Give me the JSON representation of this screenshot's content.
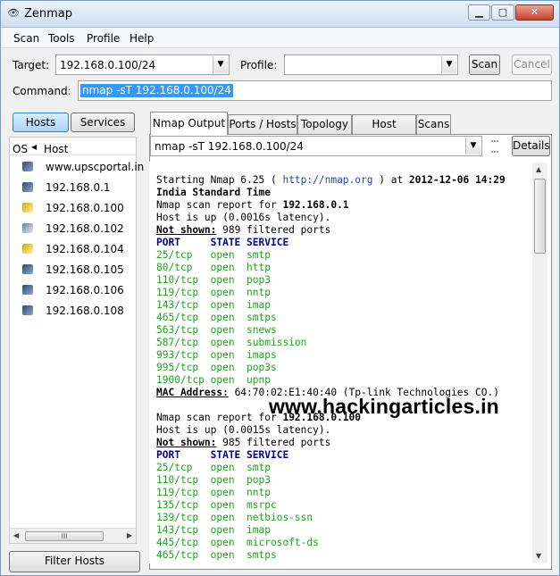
{
  "window": {
    "title": "Zenmap",
    "min_symbol": "▁",
    "max_symbol": "▢",
    "close_symbol": "✕",
    "app_icon": "eye-icon",
    "app_icon_glyph": "👁"
  },
  "menu": [
    "Scan",
    "Tools",
    "Profile",
    "Help"
  ],
  "target": {
    "label": "Target:",
    "value": "192.168.0.100/24"
  },
  "profile": {
    "label": "Profile:",
    "value": ""
  },
  "buttons": {
    "scan": "Scan",
    "cancel": "Cancel",
    "details": "Details",
    "filter_hosts": "Filter Hosts",
    "dropdown_glyph": "▼"
  },
  "command": {
    "label": "Command:",
    "value": "nmap -sT 192.168.0.100/24"
  },
  "toggles": {
    "hosts": "Hosts",
    "services": "Services"
  },
  "host_list": {
    "col_os": "OS",
    "col_host": "Host",
    "sort_glyph": "◀",
    "hosts": [
      {
        "name": "www.upscportal.in",
        "os": "win"
      },
      {
        "name": "192.168.0.1",
        "os": "win"
      },
      {
        "name": "192.168.0.100",
        "os": "lin"
      },
      {
        "name": "192.168.0.102",
        "os": "gen"
      },
      {
        "name": "192.168.0.104",
        "os": "lin"
      },
      {
        "name": "192.168.0.105",
        "os": "win"
      },
      {
        "name": "192.168.0.106",
        "os": "win"
      },
      {
        "name": "192.168.0.108",
        "os": "win"
      }
    ],
    "scroll_left": "◀",
    "scroll_right": "▶",
    "scroll_thumb": "III"
  },
  "tabs": [
    "Nmap Output",
    "Ports / Hosts",
    "Topology",
    "Host Details",
    "Scans"
  ],
  "output_selector": {
    "value": "nmap -sT 192.168.0.100/24"
  },
  "scrollbar": {
    "up": "▲",
    "down": "▼"
  },
  "output": {
    "lines": [
      [
        [
          "Starting Nmap 6.25 ( ",
          ""
        ],
        [
          "http://nmap.org",
          "link"
        ],
        [
          " ) at ",
          ""
        ],
        [
          "2012-12-06 14:29",
          "b"
        ]
      ],
      [
        [
          "India Standard Time",
          "b"
        ]
      ],
      [
        [
          "Nmap scan report for ",
          ""
        ],
        [
          "192.168.0.1",
          "b"
        ]
      ],
      [
        [
          "Host is up (0.0016s latency).",
          ""
        ]
      ],
      [
        [
          "Not shown:",
          "u"
        ],
        [
          " 989 filtered ports",
          ""
        ]
      ],
      [
        [
          "PORT     STATE SERVICE",
          "navy"
        ]
      ],
      [
        [
          "25/tcp   open  smtp",
          "green"
        ]
      ],
      [
        [
          "80/tcp   open  http",
          "green"
        ]
      ],
      [
        [
          "110/tcp  open  pop3",
          "green"
        ]
      ],
      [
        [
          "119/tcp  open  nntp",
          "green"
        ]
      ],
      [
        [
          "143/tcp  open  imap",
          "green"
        ]
      ],
      [
        [
          "465/tcp  open  smtps",
          "green"
        ]
      ],
      [
        [
          "563/tcp  open  snews",
          "green"
        ]
      ],
      [
        [
          "587/tcp  open  submission",
          "green"
        ]
      ],
      [
        [
          "993/tcp  open  imaps",
          "green"
        ]
      ],
      [
        [
          "995/tcp  open  pop3s",
          "green"
        ]
      ],
      [
        [
          "1900/tcp open  upnp",
          "green"
        ]
      ],
      [
        [
          "MAC Address:",
          "u"
        ],
        [
          " 64:70:02:E1:40:40 (Tp-link Technologies CO.)",
          ""
        ]
      ],
      [
        [
          "",
          ""
        ]
      ],
      [
        [
          "Nmap scan report for ",
          ""
        ],
        [
          "192.168.0.100",
          "b"
        ]
      ],
      [
        [
          "Host is up (0.0015s latency).",
          ""
        ]
      ],
      [
        [
          "Not shown:",
          "u"
        ],
        [
          " 985 filtered ports",
          ""
        ]
      ],
      [
        [
          "PORT     STATE SERVICE",
          "navy"
        ]
      ],
      [
        [
          "25/tcp   open  smtp",
          "green"
        ]
      ],
      [
        [
          "110/tcp  open  pop3",
          "green"
        ]
      ],
      [
        [
          "119/tcp  open  nntp",
          "green"
        ]
      ],
      [
        [
          "135/tcp  open  msrpc",
          "green"
        ]
      ],
      [
        [
          "139/tcp  open  netbios-ssn",
          "green"
        ]
      ],
      [
        [
          "143/tcp  open  imap",
          "green"
        ]
      ],
      [
        [
          "445/tcp  open  microsoft-ds",
          "green"
        ]
      ],
      [
        [
          "465/tcp  open  smtps",
          "green"
        ]
      ]
    ]
  },
  "watermark": "www.hackingarticles.in",
  "colors": {
    "open_port": "#1aa61a",
    "header": "#000090",
    "link": "#2844b8",
    "selection": "#3399ff"
  }
}
